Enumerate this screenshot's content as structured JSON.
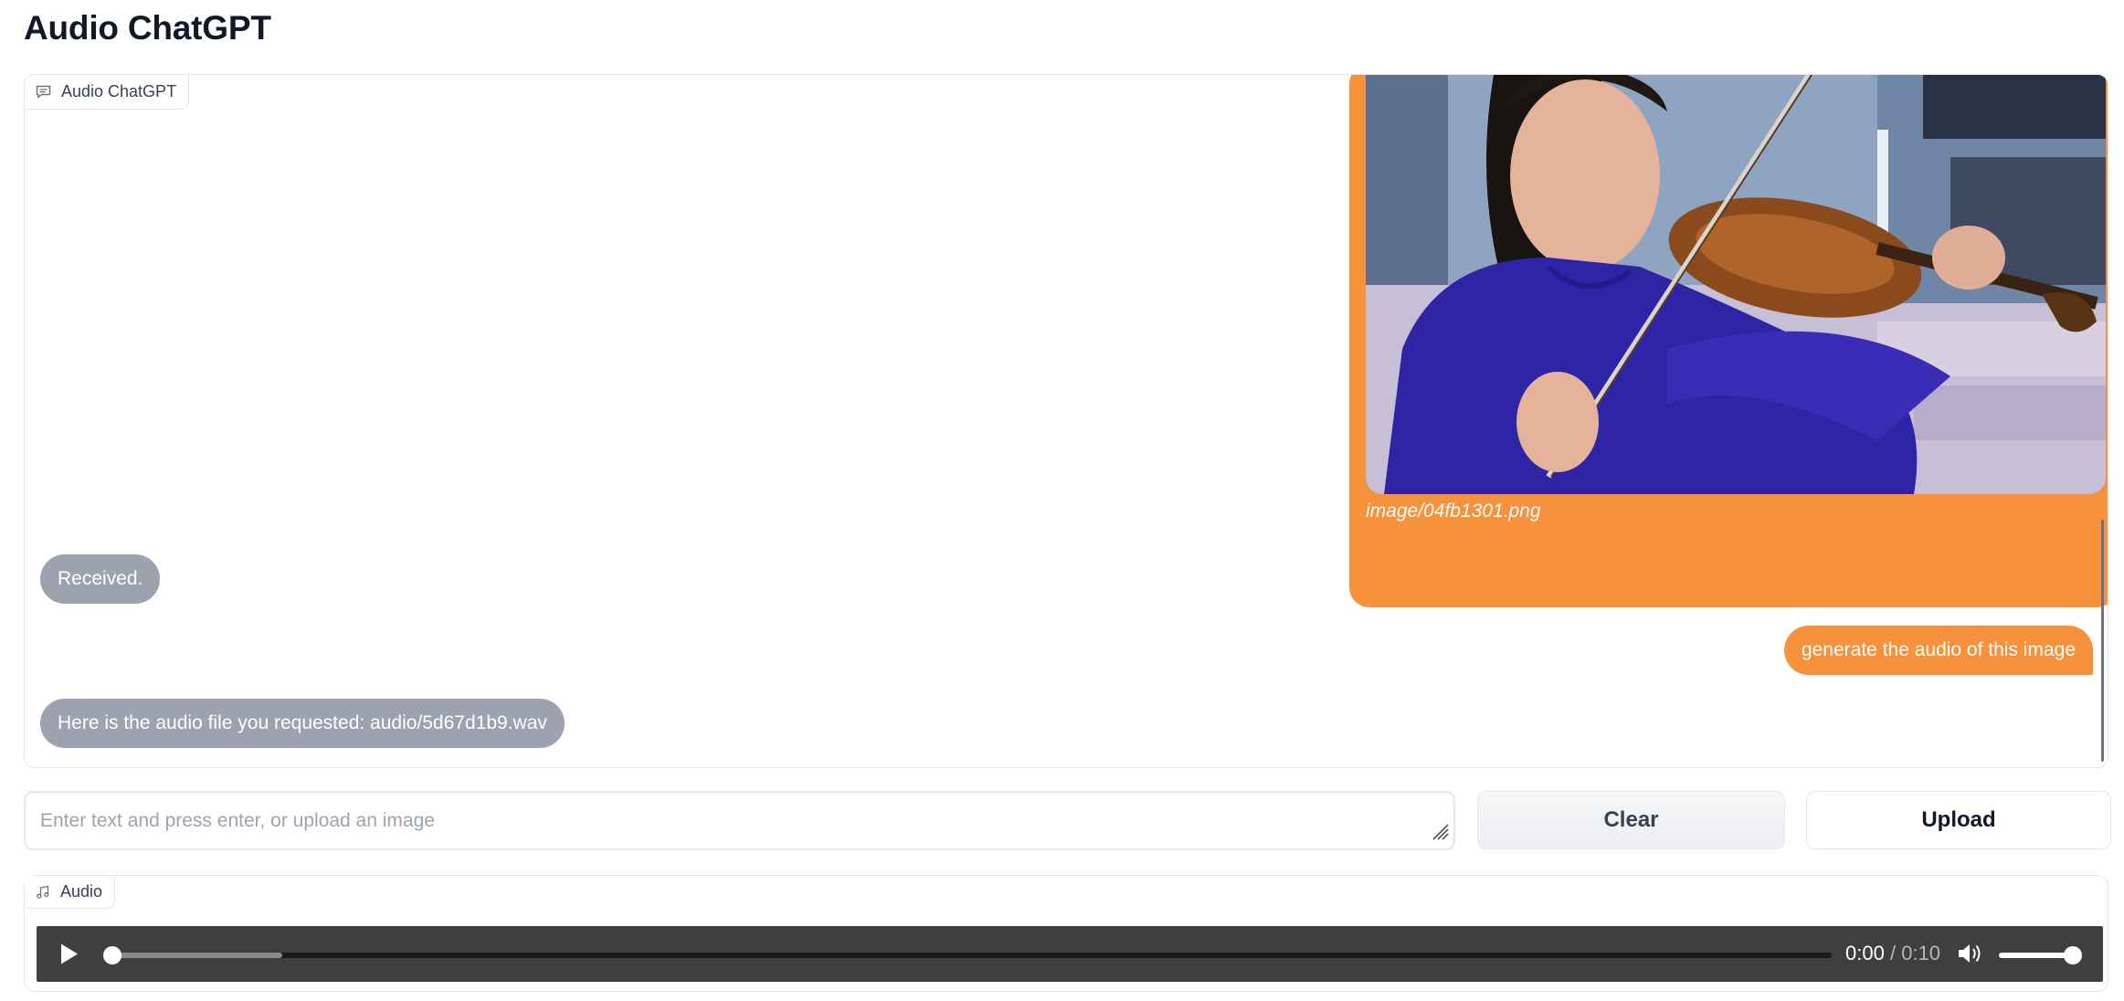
{
  "app": {
    "title": "Audio ChatGPT"
  },
  "chatbot": {
    "label": "Audio ChatGPT",
    "messages": [
      {
        "role": "user",
        "type": "image",
        "caption": "image/04fb1301.png"
      },
      {
        "role": "bot",
        "text": "Received."
      },
      {
        "role": "user",
        "text": "generate the audio of this image"
      },
      {
        "role": "bot",
        "text": "Here is the audio file you requested: audio/5d67d1b9.wav"
      }
    ]
  },
  "input": {
    "placeholder": "Enter text and press enter, or upload an image",
    "value": ""
  },
  "buttons": {
    "clear_label": "Clear",
    "upload_label": "Upload"
  },
  "audio": {
    "label": "Audio",
    "current_time": "0:00",
    "separator": "/",
    "duration": "0:10",
    "buffered_fraction": 0.1,
    "played_fraction": 0.0,
    "volume_fraction": 1.0
  },
  "colors": {
    "user_bubble": "#f7913c",
    "bot_bubble": "#9ca3af",
    "player_bg": "#3f3f3f"
  },
  "icons": {
    "chat_label": "chat-bubble-icon",
    "audio_label": "music-note-icon",
    "play": "play-icon",
    "volume": "volume-icon",
    "resize": "resize-grip-icon"
  }
}
